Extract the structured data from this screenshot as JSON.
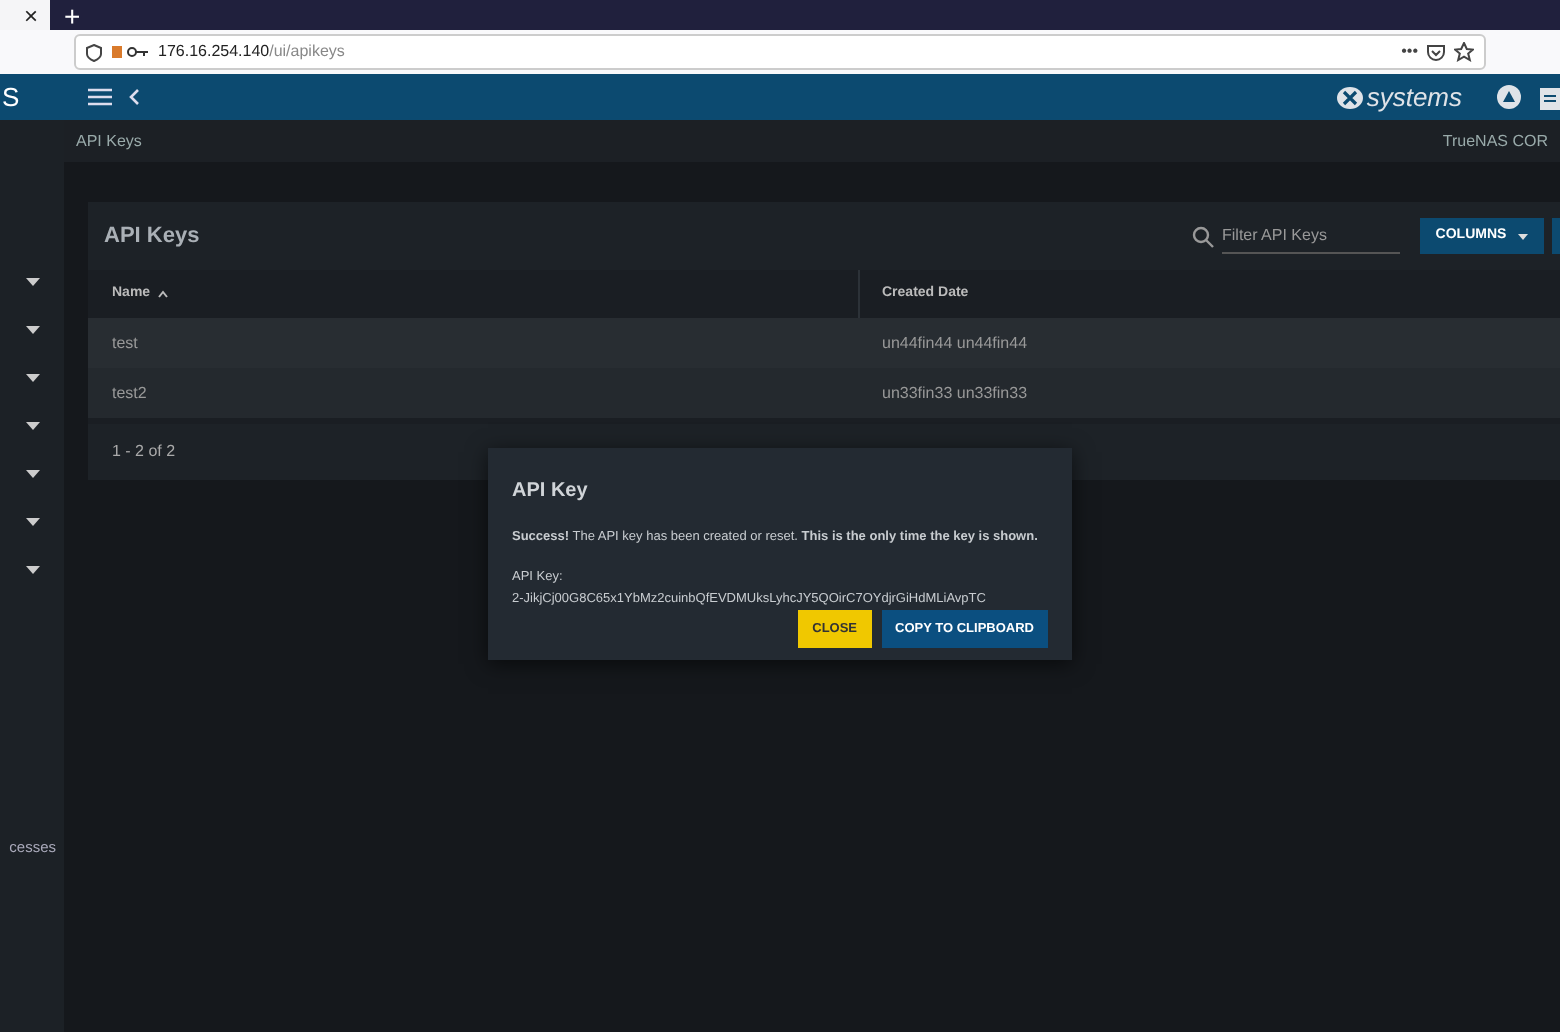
{
  "browser": {
    "tab_close": "×",
    "new_tab": "+",
    "url_host": "176.16.254.140",
    "url_path": "/ui/apikeys",
    "menu": "•••"
  },
  "header": {
    "logo_fragment": "S",
    "brand": "systems"
  },
  "sidebar": {
    "items": [
      {
        "kind": "caret"
      },
      {
        "kind": "caret"
      },
      {
        "kind": "caret"
      },
      {
        "kind": "caret"
      },
      {
        "kind": "caret"
      },
      {
        "kind": "caret"
      },
      {
        "kind": "caret"
      }
    ],
    "bottom_label": "cesses"
  },
  "breadcrumb": "API Keys",
  "product": "TrueNAS COR",
  "table": {
    "title": "API Keys",
    "filter": {
      "placeholder": "Filter API Keys"
    },
    "columns_button": "COLUMNS",
    "columns": [
      {
        "label": "Name",
        "sorted": true
      },
      {
        "label": "Created Date",
        "sorted": false
      }
    ],
    "rows": [
      {
        "cells": [
          "test",
          "un44fin44 un44fin44"
        ]
      },
      {
        "cells": [
          "test2",
          "un33fin33 un33fin33"
        ]
      }
    ],
    "pager": "1 - 2 of 2"
  },
  "dialog": {
    "title": "API Key",
    "message": "**Success!** The API key has been created or reset. **This is the only time the key is shown.**",
    "key_label": "API Key:",
    "key_value": "2-JikjCj00G8C65x1YbMz2cuinbQfEVDMUksLyhcJY5QOirC7OYdjrGiHdMLiAvpTC",
    "buttons": [
      {
        "label": "CLOSE",
        "kind": "secondary"
      },
      {
        "label": "COPY TO CLIPBOARD",
        "kind": "primary"
      }
    ]
  }
}
